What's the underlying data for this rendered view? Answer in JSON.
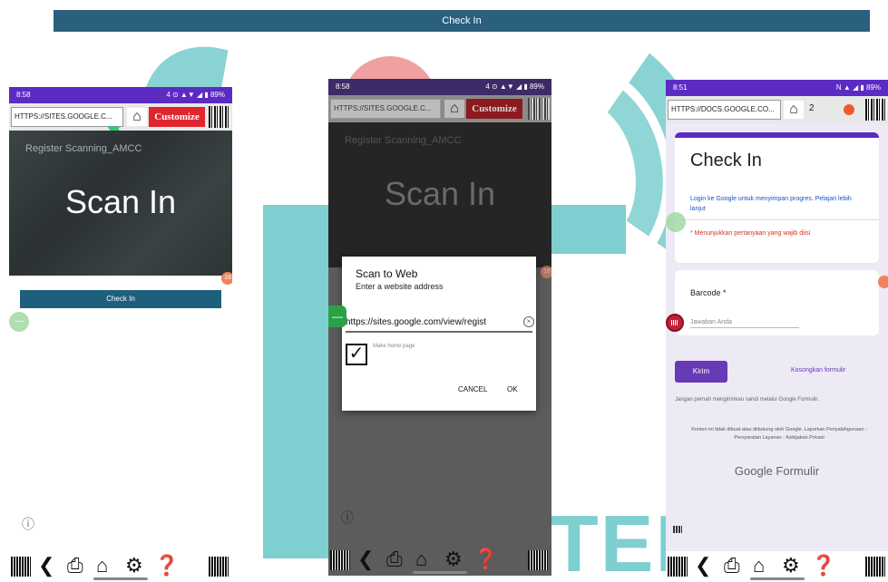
{
  "top_banner": {
    "label": "Check In"
  },
  "phone1": {
    "status_time": "8:58",
    "status_right": "4 ⊙ ▲▼ ◢ ▮ 89%",
    "url": "HTTPS://SITES.GOOGLE.C...",
    "customize_label": "Customize",
    "hero_subtitle": "Register Scanning_AMCC",
    "hero_title": "Scan In",
    "check_in_label": "Check In"
  },
  "phone2": {
    "status_time": "8:58",
    "status_right": "4 ⊙ ▲▼ ◢ ▮ 89%",
    "url": "HTTPS://SITES.GOOGLE.C...",
    "customize_label": "Customize",
    "hero_subtitle": "Register Scanning_AMCC",
    "hero_title": "Scan In",
    "dialog": {
      "title": "Scan to Web",
      "subtitle": "Enter a website address",
      "url_value": "https://sites.google.com/view/regist",
      "checkbox_label": "Make home page",
      "cancel_label": "CANCEL",
      "ok_label": "OK"
    }
  },
  "phone3": {
    "status_time": "8:51",
    "status_right": "N ▲ ◢ ▮ 89%",
    "url": "HTTPS://DOCS.GOOGLE.CO...",
    "tab_count": "2",
    "form": {
      "title": "Check In",
      "login_text": "Login ke Google untuk menyimpan progres. Pelajari lebih lanjut",
      "required_text": "* Menunjukkan pertanyaan yang wajib diisi",
      "question_label": "Barcode *",
      "answer_placeholder": "Jawaban Anda",
      "submit_label": "Kirim",
      "clear_label": "Kosongkan formulir",
      "warning": "Jangan pernah mengirimkan sandi melalui Google Formulir.",
      "disclaimer": "Konten ini tidak dibuat atau didukung oleh Google. Laporkan Penyalahgunaan - Persyaratan Layanan - Kebijakan Privasi",
      "brand": "Google Formulir"
    }
  },
  "watermark": {
    "text": "TEK"
  },
  "colors": {
    "purple": "#5b2bc4",
    "red": "#e0262d",
    "teal": "#7ecfd0",
    "navy": "#1f5f7e"
  }
}
